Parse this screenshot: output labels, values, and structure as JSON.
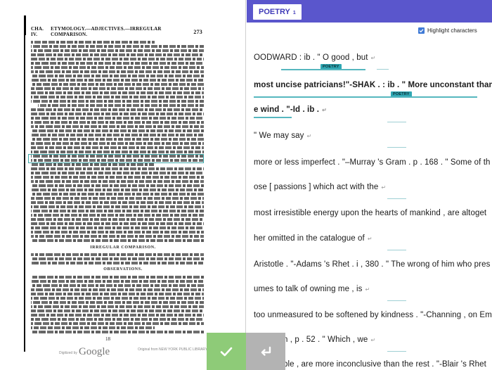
{
  "scan": {
    "running_head": "ETYMOLOGY.—ADJECTIVES.—IRREGULAR COMPARISON.",
    "section_label": "CHA. IV.",
    "page_number": "273",
    "heading_1": "IRREGULAR COMPARISON.",
    "heading_2": "OBSERVATIONS.",
    "footer_number": "18",
    "digitized_by": "Digitized by",
    "google": "Google",
    "library": "Original from NEW YORK PUBLIC LIBRARY"
  },
  "header": {
    "tab_label": "POETRY",
    "tab_count": "1"
  },
  "options": {
    "highlight_label": "Highlight characters",
    "highlight_checked": true
  },
  "tag_label": "POETRY",
  "lines": [
    {
      "text": "OODWARD : ib . \" O good , but"
    },
    {
      "text": "most uncise patricians!\"-SHAK . : ib . \" More unconstant than th"
    },
    {
      "text": "e wind . \"-Id . ib ."
    },
    {
      "text": "\" We may say"
    },
    {
      "text": "more or less imperfect . \"–Murray 's Gram . p . 168 . \" Some of th"
    },
    {
      "text": "ose [ passions ] which act with the"
    },
    {
      "text": "most irresistible energy upon the hearts of mankind , are altoget"
    },
    {
      "text": "her omitted in the catalogue of"
    },
    {
      "text": "Aristotle . \"-Adams 's Rhet . i , 380 . \" The wrong of him who pres"
    },
    {
      "text": "umes to talk of owning me , is"
    },
    {
      "text": "too unmeasured to be softened by kindness . \"-Channing , on Em"
    },
    {
      "text": "n , p . 52 . \" Which , we"
    },
    {
      "text": "ble , are more inconclusive than the rest . \"-Blair 's Rhet"
    }
  ],
  "return_symbol": "↵",
  "colors": {
    "accent": "#5a56cc",
    "highlight": "#56b7bf",
    "confirm": "#8ecb78",
    "return": "#b3b3b3"
  }
}
